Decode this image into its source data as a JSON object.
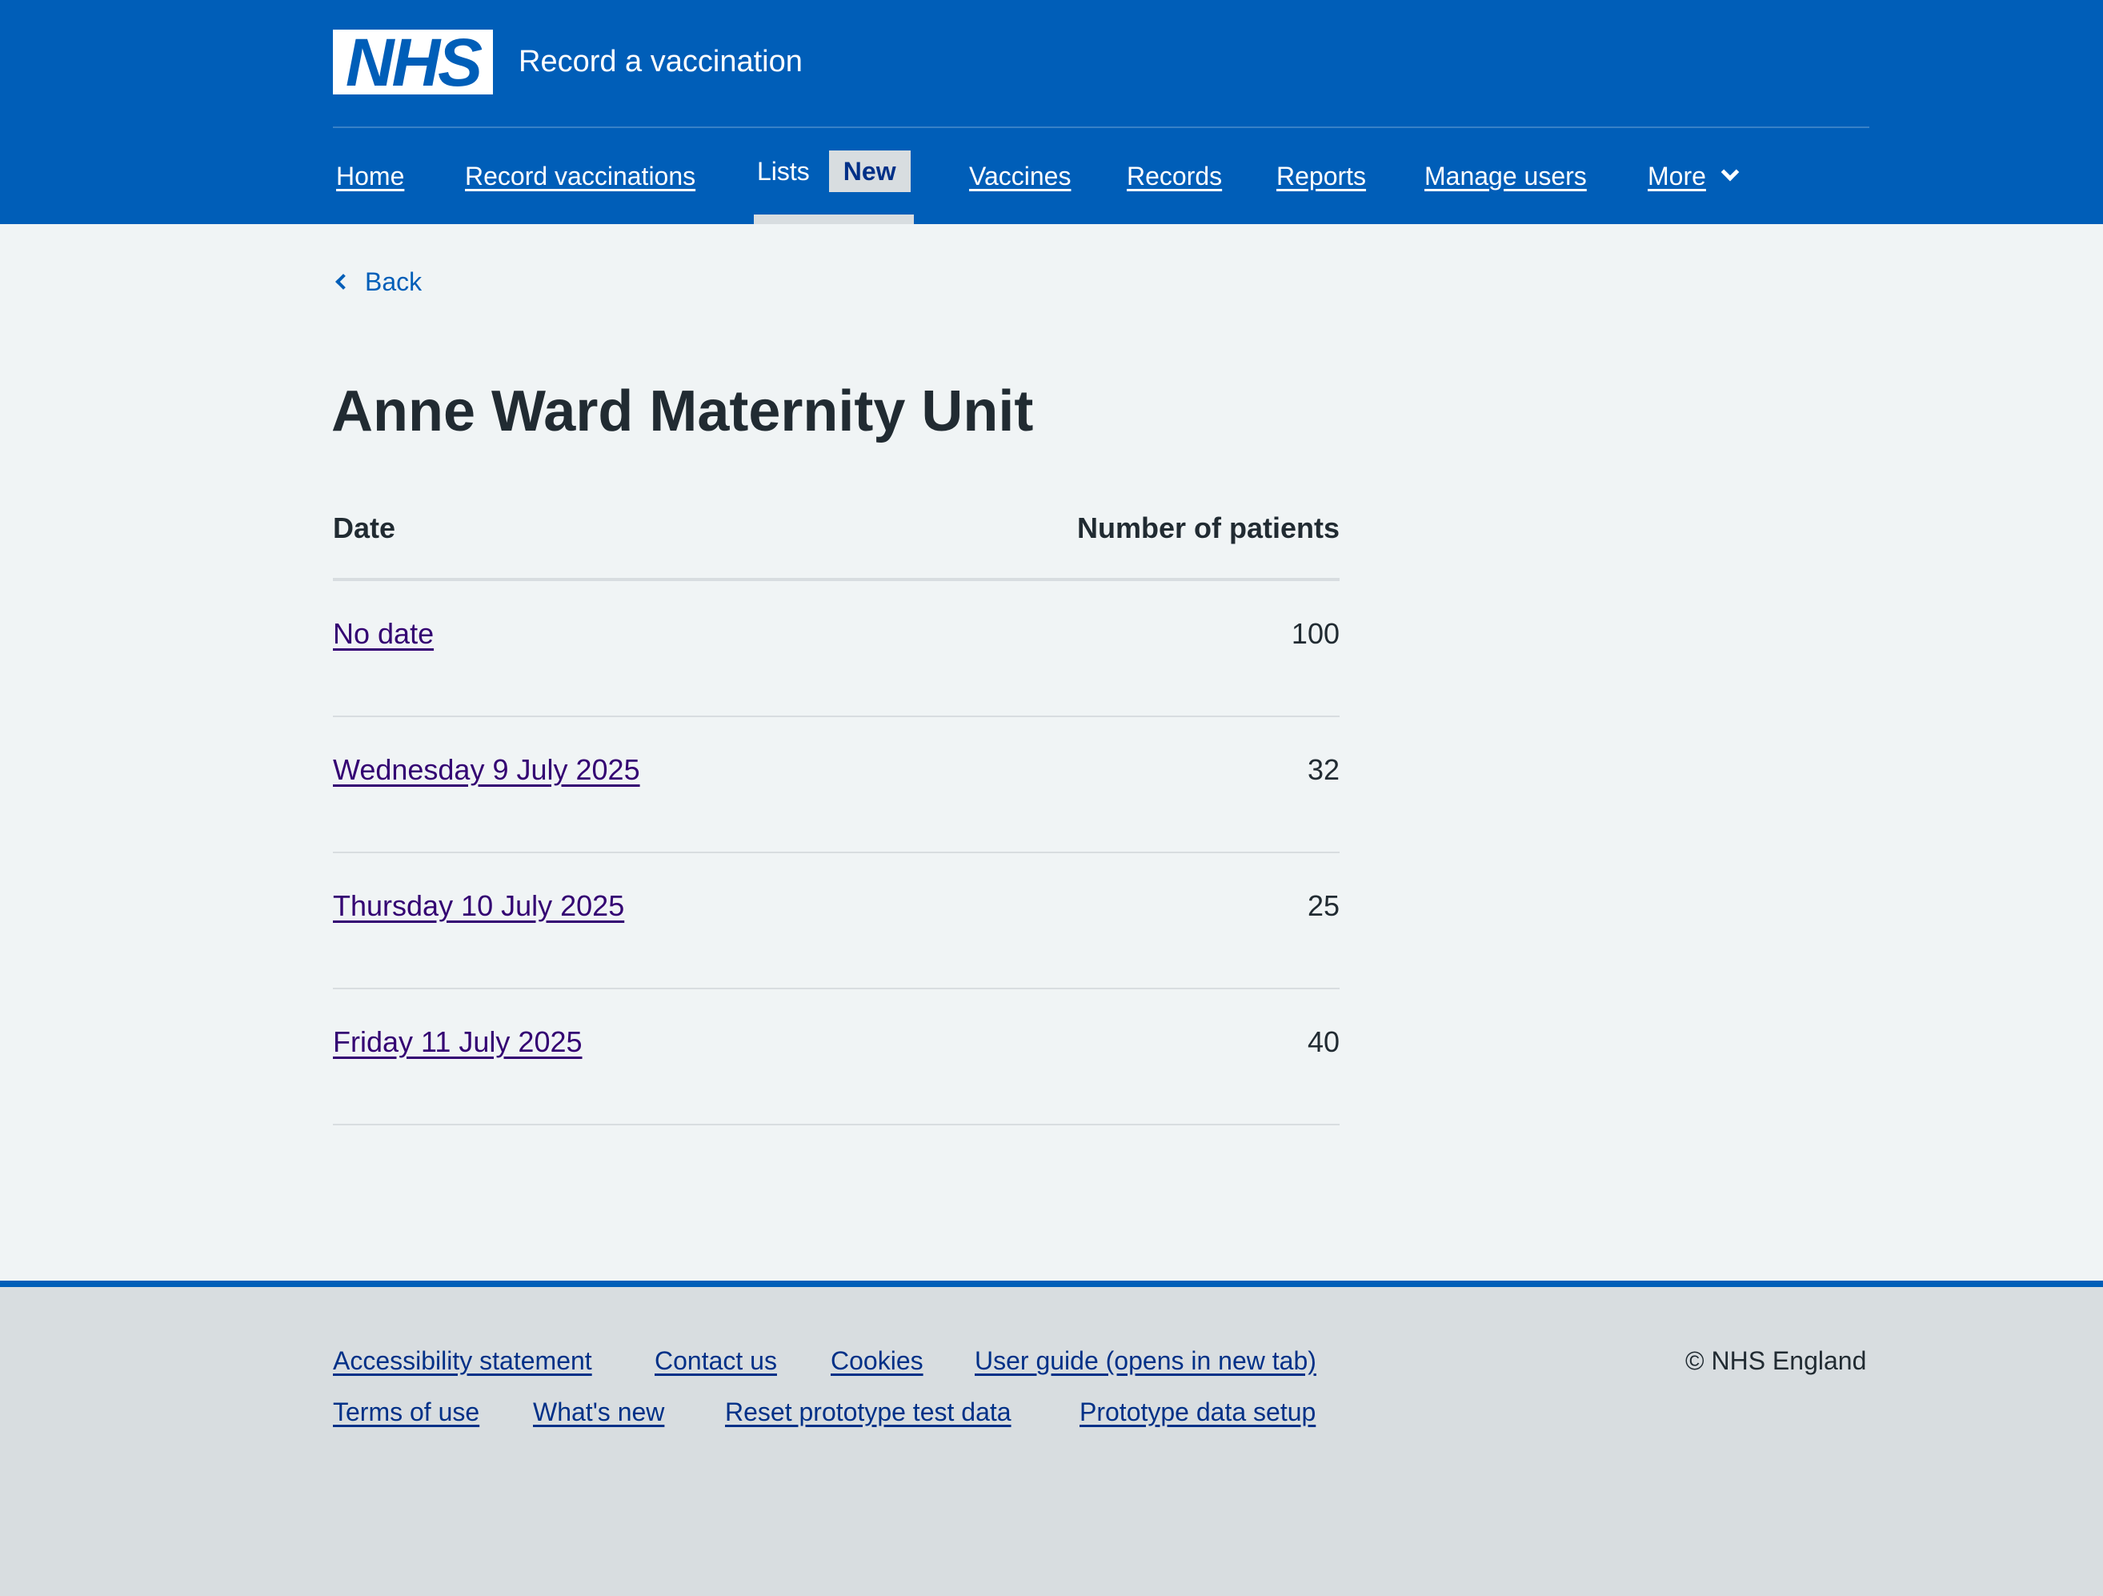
{
  "header": {
    "logo_text": "NHS",
    "service_name": "Record a vaccination",
    "nav": [
      {
        "label": "Home"
      },
      {
        "label": "Record vaccinations"
      },
      {
        "label": "Lists",
        "tag": "New",
        "active": true
      },
      {
        "label": "Vaccines"
      },
      {
        "label": "Records"
      },
      {
        "label": "Reports"
      },
      {
        "label": "Manage users"
      },
      {
        "label": "More",
        "icon": "chevron-down-icon"
      }
    ]
  },
  "back_label": "Back",
  "page_title": "Anne Ward Maternity Unit",
  "table": {
    "headers": {
      "date": "Date",
      "count": "Number of patients"
    },
    "rows": [
      {
        "date": "No date",
        "count": "100"
      },
      {
        "date": "Wednesday 9 July 2025",
        "count": "32"
      },
      {
        "date": "Thursday 10 July 2025",
        "count": "25"
      },
      {
        "date": "Friday 11 July 2025",
        "count": "40"
      }
    ]
  },
  "footer": {
    "links": [
      "Accessibility statement",
      "Contact us",
      "Cookies",
      "User guide (opens in new tab)",
      "Terms of use",
      "What's new",
      "Reset prototype test data",
      "Prototype data setup"
    ],
    "copyright": "© NHS England"
  },
  "colors": {
    "nhs_blue": "#005eb8",
    "page_background": "#f0f4f5",
    "footer_background": "#d8dde0",
    "visited_link": "#330072",
    "footer_link": "#003087",
    "text": "#212b32"
  }
}
